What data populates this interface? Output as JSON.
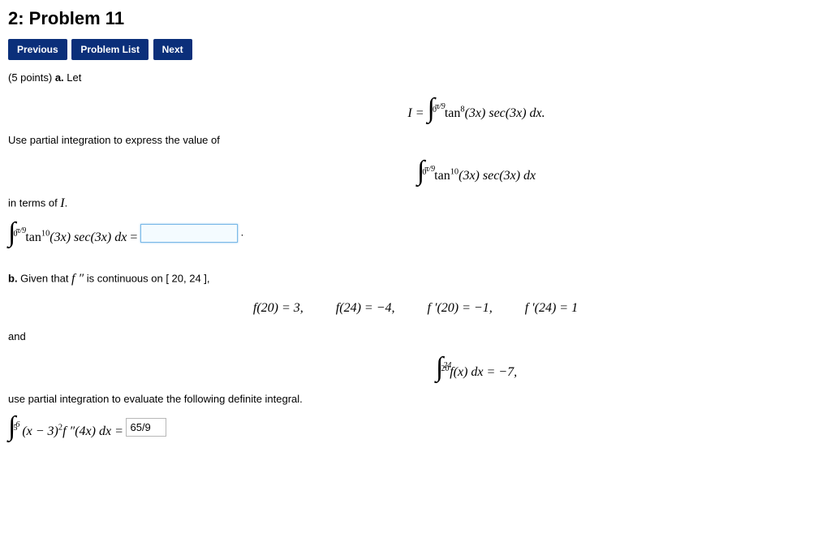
{
  "header": {
    "title": "2: Problem 11"
  },
  "nav": {
    "prev": "Previous",
    "list": "Problem List",
    "next": "Next"
  },
  "problem": {
    "points_prefix": "(5 points) ",
    "part_a_label": "a.",
    "part_a_intro": " Let",
    "eq_I_lhs": "I = ",
    "int_upper_pi9": "π/9",
    "int_lower_0": "0",
    "eq_I_integrand": "tan",
    "eq_I_exp": "8",
    "eq_I_rest": "(3x) sec(3x)  dx.",
    "a_line2": "Use partial integration to express the value of",
    "eq_J_exp": "10",
    "eq_J_rest": "(3x) sec(3x)  dx",
    "a_line3_pre": "in terms of ",
    "a_line3_I": "I",
    "a_line3_post": ".",
    "answer_a_trail": " .",
    "part_b_label": "b.",
    "part_b_intro_pre": "  Given that ",
    "part_b_fpp": "f ″",
    "part_b_intro_post": " is continuous on [ 20, 24 ],",
    "cond1": "f(20) = 3,",
    "cond2": "f(24) = −4,",
    "cond3": "f ′(20) = −1,",
    "cond4": "f ′(24) = 1",
    "and": "and",
    "int2_upper": "24",
    "int2_lower": "20",
    "int2_body": "f(x) dx = −7,",
    "b_line2": "use partial integration to evaluate the following definite integral.",
    "int3_upper": "6",
    "int3_lower": "5",
    "int3_body_pre": "(x − 3)",
    "int3_body_exp": "2",
    "int3_body_mid": "f ″(4x) dx = ",
    "answer_b_value": "65/9"
  }
}
